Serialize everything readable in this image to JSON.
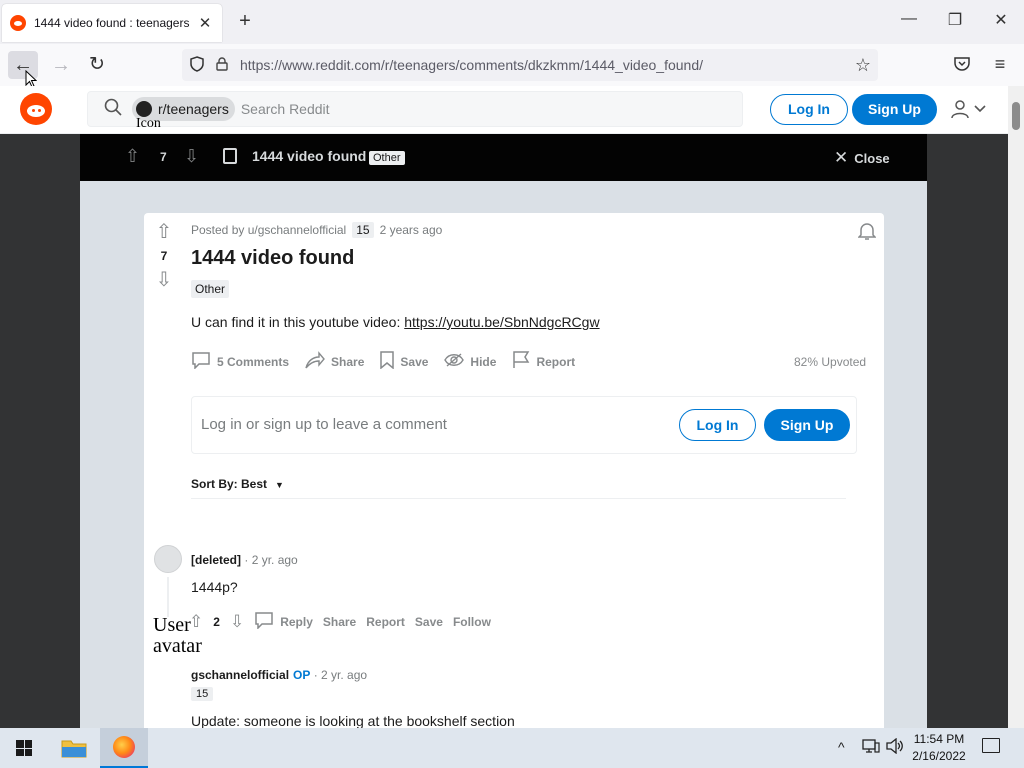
{
  "browser": {
    "tab_title": "1444 video found : teenagers",
    "tab_close": "✕",
    "new_tab": "+",
    "url": "https://www.reddit.com/r/teenagers/comments/dkzkmm/1444_video_found/",
    "win_minimize": "—",
    "win_restore": "❐",
    "win_close": "✕"
  },
  "header": {
    "subreddit_chip": "r/teenagers",
    "subreddit_icon_alt": "Icon",
    "search_placeholder": "Search Reddit",
    "login_label": "Log In",
    "signup_label": "Sign Up"
  },
  "post_bar": {
    "score": "7",
    "title": "1444 video found",
    "flair": "Other",
    "close_label": "Close"
  },
  "post": {
    "posted_by": "Posted by u/gschannelofficial",
    "author_karma": "15",
    "age": "2 years ago",
    "score": "7",
    "title": "1444 video found",
    "flair": "Other",
    "body_text": "U can find it in this youtube video: ",
    "body_link": "https://youtu.be/SbnNdgcRCgw",
    "actions": {
      "comments": "5 Comments",
      "share": "Share",
      "save": "Save",
      "hide": "Hide",
      "report": "Report"
    },
    "upvoted": "82% Upvoted"
  },
  "comment_box": {
    "prompt": "Log in or sign up to leave a comment",
    "login_label": "Log In",
    "signup_label": "Sign Up"
  },
  "sort": {
    "label": "Sort By: Best"
  },
  "comments": [
    {
      "author": "[deleted]",
      "meta": "· 2 yr. ago",
      "body": "1444p?",
      "score": "2",
      "avatar_alt": "User avatar",
      "actions": {
        "reply": "Reply",
        "share": "Share",
        "report": "Report",
        "save": "Save",
        "follow": "Follow"
      }
    },
    {
      "author": "gschannelofficial",
      "op_badge": "OP",
      "meta": "· 2 yr. ago",
      "karma": "15",
      "body": "Update: someone is looking at the bookshelf section"
    }
  ],
  "taskbar": {
    "time": "11:54 PM",
    "date": "2/16/2022"
  },
  "colors": {
    "reddit_orange": "#ff4500",
    "reddit_blue": "#0079d3",
    "post_bar_bg": "#030303",
    "overlay_bg": "#dae0e6"
  },
  "icons": [
    "reddit-favicon",
    "back-arrow",
    "forward-arrow",
    "reload",
    "shield",
    "lock",
    "bookmark-star",
    "pocket",
    "hamburger-menu",
    "search",
    "user",
    "upvote",
    "downvote",
    "document",
    "close",
    "bell",
    "comment",
    "share",
    "save",
    "hide",
    "report",
    "windows-start",
    "file-explorer",
    "firefox",
    "network",
    "volume",
    "notifications"
  ]
}
